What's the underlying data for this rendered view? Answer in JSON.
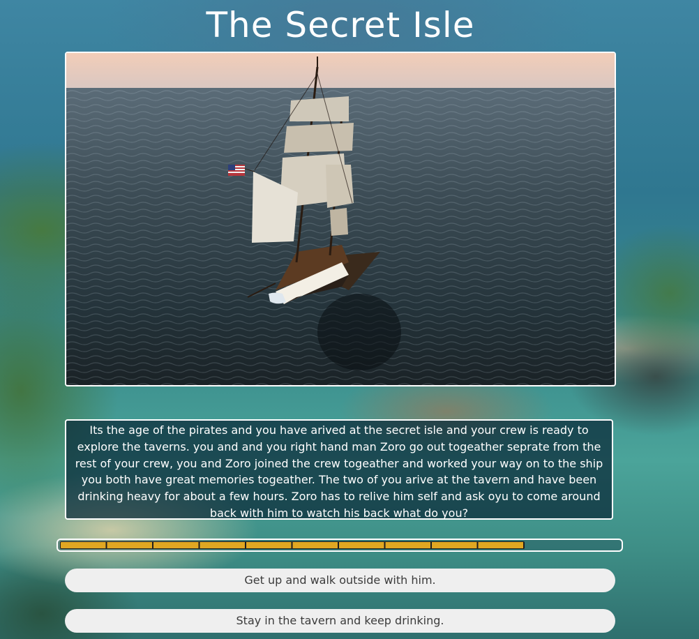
{
  "game": {
    "title": "The Secret Isle"
  },
  "scene": {
    "image": "sailing-ship-on-ocean"
  },
  "story": {
    "text": "Its the age of the pirates and you have arived at the secret isle and your crew is ready to explore the taverns. you and and you right hand man Zoro go out togeather seprate from the rest of your crew, you and Zoro joined the crew togeather and worked your way on to the ship you both have great memories togeather. The two of you arive at the tavern and have been drinking heavy for about a few hours. Zoro has to relive him self and ask oyu to come around back with him to watch his back what do you?"
  },
  "progress": {
    "fraction": 0.83,
    "segments_filled": 10,
    "fill_color": "#e0a722"
  },
  "choices": [
    {
      "label": "Get up and walk outside with him."
    },
    {
      "label": "Stay in the tavern and keep drinking."
    }
  ]
}
